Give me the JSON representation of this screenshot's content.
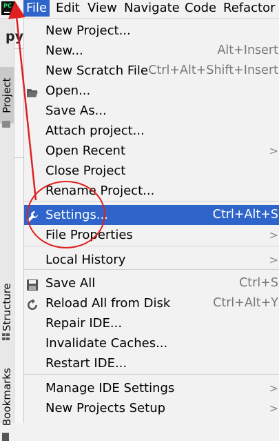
{
  "menubar": {
    "items": [
      {
        "label": "File"
      },
      {
        "label": "Edit"
      },
      {
        "label": "View"
      },
      {
        "label": "Navigate"
      },
      {
        "label": "Code"
      },
      {
        "label": "Refactor"
      }
    ],
    "active_index": 0
  },
  "project_title_fragment": "py",
  "sidebar": {
    "tabs": [
      "Project",
      "Structure",
      "Bookmarks"
    ]
  },
  "file_menu": {
    "items": [
      {
        "label": "New Project...",
        "shortcut": ""
      },
      {
        "label": "New...",
        "shortcut": "Alt+Insert"
      },
      {
        "label": "New Scratch File",
        "shortcut": "Ctrl+Alt+Shift+Insert"
      },
      {
        "label": "Open...",
        "shortcut": "",
        "icon": "folder-open-icon"
      },
      {
        "label": "Save As...",
        "shortcut": ""
      },
      {
        "label": "Attach project...",
        "shortcut": ""
      },
      {
        "label": "Open Recent",
        "shortcut": "",
        "submenu": true
      },
      {
        "label": "Close Project",
        "shortcut": ""
      },
      {
        "label": "Rename Project...",
        "shortcut": ""
      },
      {
        "label": "Settings...",
        "shortcut": "Ctrl+Alt+S",
        "icon": "wrench-icon",
        "selected": true
      },
      {
        "label": "File Properties",
        "shortcut": "",
        "submenu": true
      },
      {
        "label": "Local History",
        "shortcut": "",
        "submenu": true
      },
      {
        "label": "Save All",
        "shortcut": "Ctrl+S",
        "icon": "save-icon"
      },
      {
        "label": "Reload All from Disk",
        "shortcut": "Ctrl+Alt+Y",
        "icon": "reload-icon"
      },
      {
        "label": "Repair IDE...",
        "shortcut": ""
      },
      {
        "label": "Invalidate Caches...",
        "shortcut": ""
      },
      {
        "label": "Restart IDE...",
        "shortcut": ""
      },
      {
        "label": "Manage IDE Settings",
        "shortcut": "",
        "submenu": true
      },
      {
        "label": "New Projects Setup",
        "shortcut": "",
        "submenu": true
      }
    ]
  },
  "colors": {
    "accent": "#2f65ca",
    "annotation_red": "#e02020"
  },
  "submenu_glyph": ">"
}
